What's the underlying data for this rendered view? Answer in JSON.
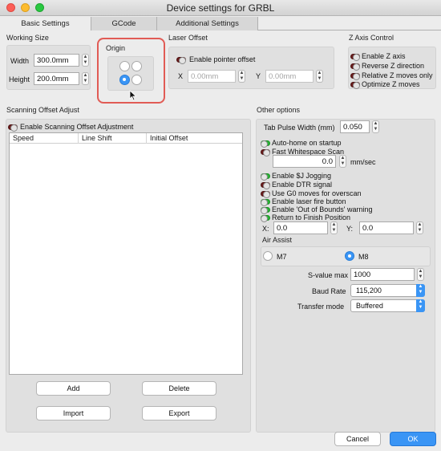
{
  "window": {
    "title": "Device settings for GRBL"
  },
  "tabs": [
    {
      "label": "Basic Settings",
      "active": true
    },
    {
      "label": "GCode",
      "active": false
    },
    {
      "label": "Additional Settings",
      "active": false
    }
  ],
  "working_size": {
    "title": "Working Size",
    "width_label": "Width",
    "width_value": "300.0mm",
    "height_label": "Height",
    "height_value": "200.0mm"
  },
  "origin": {
    "title": "Origin",
    "selected": "bottom-left",
    "highlight_color": "#e15b55"
  },
  "laser_offset": {
    "title": "Laser Offset",
    "enable_label": "Enable pointer offset",
    "enabled": false,
    "x_label": "X",
    "x_value": "0.00mm",
    "y_label": "Y",
    "y_value": "0.00mm"
  },
  "z_axis": {
    "title": "Z Axis Control",
    "options": [
      {
        "label": "Enable Z axis",
        "on": false
      },
      {
        "label": "Reverse Z direction",
        "on": false
      },
      {
        "label": "Relative Z moves only",
        "on": false
      },
      {
        "label": "Optimize Z moves",
        "on": false
      }
    ]
  },
  "scanning": {
    "title": "Scanning Offset Adjust",
    "enable_label": "Enable Scanning Offset Adjustment",
    "enabled": false,
    "columns": [
      "Speed",
      "Line Shift",
      "Initial Offset"
    ],
    "add_label": "Add",
    "delete_label": "Delete",
    "import_label": "Import",
    "export_label": "Export"
  },
  "other": {
    "title": "Other options",
    "tab_pulse_label": "Tab Pulse Width (mm)",
    "tab_pulse_value": "0.050",
    "auto_home_label": "Auto-home on startup",
    "auto_home_on": true,
    "fast_ws_label": "Fast Whitespace Scan",
    "fast_ws_on": false,
    "fast_ws_value": "0.0",
    "fast_ws_unit": "mm/sec",
    "toggles": [
      {
        "label": "Enable $J Jogging",
        "on": true
      },
      {
        "label": "Enable DTR signal",
        "on": false
      },
      {
        "label": "Use G0 moves for overscan",
        "on": false
      },
      {
        "label": "Enable laser fire button",
        "on": true
      },
      {
        "label": "Enable 'Out of Bounds' warning",
        "on": true
      },
      {
        "label": "Return to Finish Position",
        "on": true
      }
    ],
    "x_label": "X:",
    "x_value": "0.0",
    "y_label": "Y:",
    "y_value": "0.0",
    "air_assist_title": "Air Assist",
    "m7_label": "M7",
    "m8_label": "M8",
    "air_selected": "M8",
    "svalue_label": "S-value max",
    "svalue_value": "1000",
    "baud_label": "Baud Rate",
    "baud_value": "115,200",
    "transfer_label": "Transfer mode",
    "transfer_value": "Buffered"
  },
  "footer": {
    "cancel_label": "Cancel",
    "ok_label": "OK"
  }
}
